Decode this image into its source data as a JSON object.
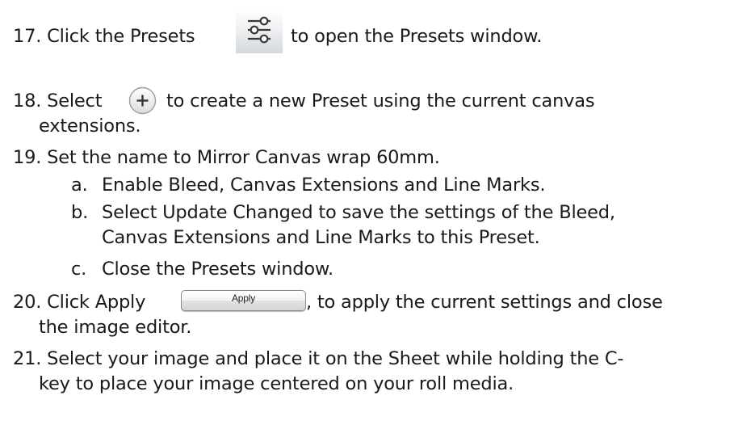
{
  "steps": [
    {
      "id": "17",
      "before": "17. Click the Presets ",
      "after": " to open the Presets window."
    },
    {
      "id": "18",
      "before": "18. Select ",
      "after": " to create a new Preset using the current canvas",
      "cont": "extensions."
    },
    {
      "id": "19",
      "text": "19. Set the name to Mirror Canvas wrap 60mm."
    },
    {
      "id": "19a",
      "marker": "a.",
      "text": "Enable Bleed, Canvas Extensions and Line Marks."
    },
    {
      "id": "19b",
      "marker": "b.",
      "text": "Select Update Changed to save the settings of the Bleed,",
      "cont": "Canvas Extensions and Line Marks to this Preset."
    },
    {
      "id": "19c",
      "marker": "c.",
      "text": "Close the Presets window."
    },
    {
      "id": "20",
      "before": "20. Click Apply ",
      "after": ", to apply the current settings and close",
      "cont": "the image editor."
    },
    {
      "id": "21",
      "text": "21. Select your image and place it on the Sheet while holding the C-",
      "cont": "key to place your image centered on your roll media."
    }
  ],
  "apply_button_label": "Apply",
  "icons": {
    "presets": "sliders-icon",
    "add_preset": "circle-plus-icon"
  }
}
